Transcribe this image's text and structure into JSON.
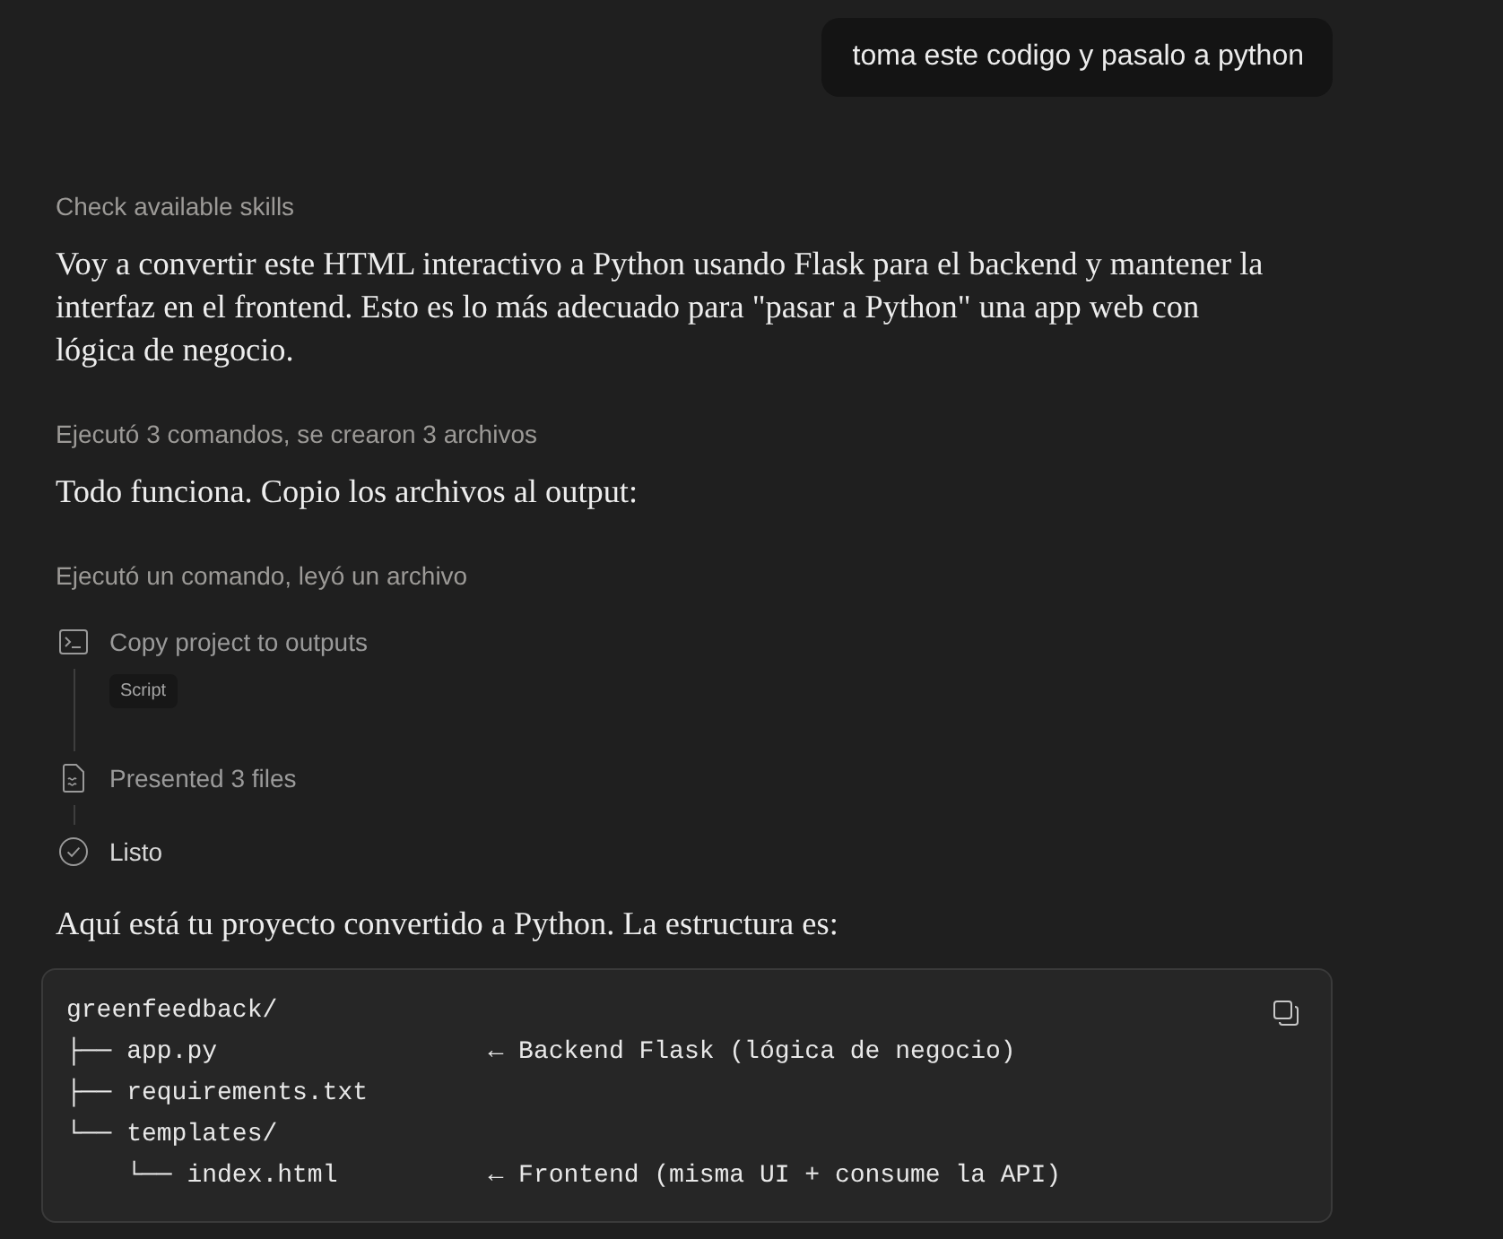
{
  "user_message": {
    "text": "toma este codigo y pasalo a python"
  },
  "response": [
    {
      "kind": "activity",
      "text": "Check available skills"
    },
    {
      "kind": "paragraph",
      "text": "Voy a convertir este HTML interactivo a Python usando Flask para el backend y mantener la interfaz en el frontend. Esto es lo más adecuado para \"pasar a Python\" una app web con lógica de negocio."
    },
    {
      "kind": "activity",
      "text": "Ejecutó 3 comandos, se crearon 3 archivos"
    },
    {
      "kind": "paragraph",
      "text": "Todo funciona. Copio los archivos al output:"
    },
    {
      "kind": "activity",
      "text": "Ejecutó un comando, leyó un archivo"
    },
    {
      "kind": "steps",
      "steps": [
        {
          "kind": "terminal",
          "label": "Copy project to outputs",
          "tag": "Script"
        },
        {
          "kind": "file",
          "label": "Presented 3 files"
        },
        {
          "kind": "done",
          "label": "Listo"
        }
      ]
    },
    {
      "kind": "paragraph",
      "text": "Aquí está tu proyecto convertido a Python. La estructura es:"
    },
    {
      "kind": "code",
      "lines": [
        "greenfeedback/",
        "├── app.py                  ← Backend Flask (lógica de negocio)",
        "├── requirements.txt",
        "└── templates/",
        "    └── index.html          ← Frontend (misma UI + consume la API)"
      ]
    }
  ]
}
